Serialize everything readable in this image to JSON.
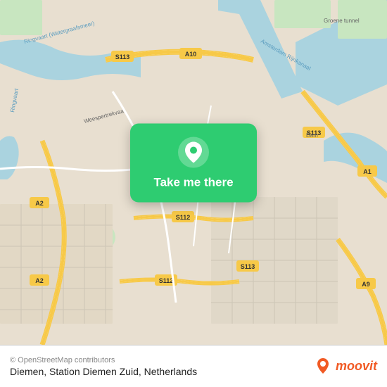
{
  "map": {
    "center_label": "Diemen, Station Diemen Zuid",
    "region": "Netherlands",
    "copyright": "© OpenStreetMap contributors",
    "bg_color": "#e8dfd0",
    "water_color": "#aad3df",
    "road_yellow": "#f7c948",
    "road_white": "#ffffff",
    "green_area": "#c8e6c0",
    "highway_label_color": "#555"
  },
  "popup": {
    "label": "Take me there",
    "bg_color": "#2ecc71",
    "pin_color": "#fff"
  },
  "footer": {
    "copyright": "© OpenStreetMap contributors",
    "location": "Diemen, Station Diemen Zuid, Netherlands",
    "moovit_label": "moovit"
  }
}
